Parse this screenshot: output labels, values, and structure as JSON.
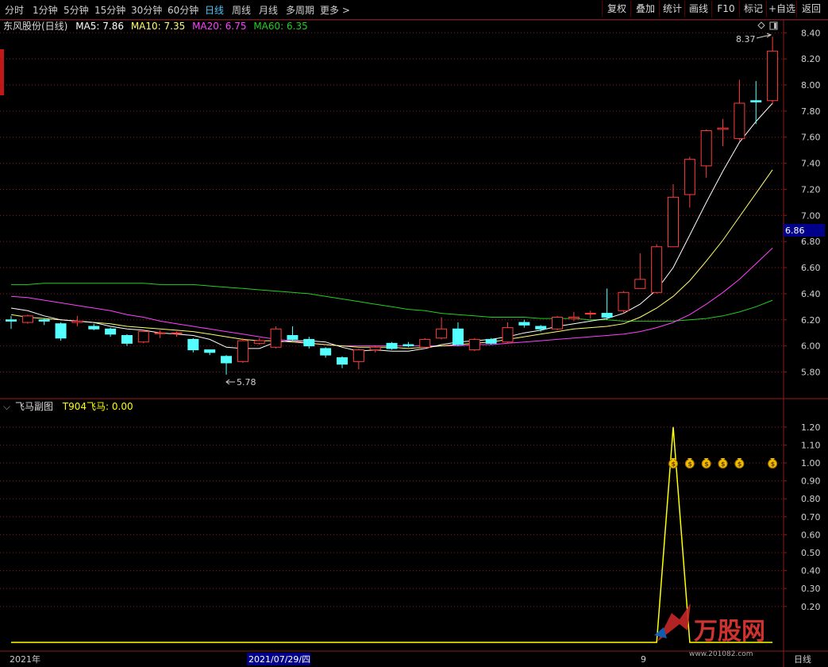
{
  "toolbar": {
    "periods": [
      "分时",
      "1分钟",
      "5分钟",
      "15分钟",
      "30分钟",
      "60分钟",
      "日线",
      "周线",
      "月线",
      "多周期",
      "更多 >"
    ],
    "active_period": "日线",
    "right_buttons": [
      "复权",
      "叠加",
      "统计",
      "画线",
      "F10",
      "标记",
      "+自选",
      "返回"
    ]
  },
  "main_header": {
    "title": "东风股份(日线)",
    "ma5": "MA5: 7.86",
    "ma10": "MA10: 7.35",
    "ma20": "MA20: 6.75",
    "ma60": "MA60: 6.35"
  },
  "sub_header": {
    "title": "飞马副图",
    "indicator": "T904飞马: 0.00"
  },
  "annotations": {
    "high": "8.37",
    "low": "5.78",
    "price_marker": "6.86",
    "period_corner": "日线"
  },
  "footer": {
    "year": "2021年",
    "cursor_date": "2021/07/29/四",
    "month_mark": "9"
  },
  "watermark": {
    "text": "万股网",
    "url": "www.201082.com"
  },
  "colors": {
    "up": "#ff3c3c",
    "down": "#54ffff",
    "ma5": "#ffffff",
    "ma10": "#ffff6e",
    "ma20": "#ff40ff",
    "ma60": "#20d020",
    "grid": "#8b1a1a",
    "indicator": "#ffff00",
    "price_marker_bg": "#00008b"
  },
  "chart_data": [
    {
      "type": "candlestick",
      "title": "东风股份(日线)",
      "y_ticks": [
        "8.40",
        "8.20",
        "8.00",
        "7.80",
        "7.60",
        "7.40",
        "7.20",
        "7.00",
        "6.80",
        "6.60",
        "6.40",
        "6.20",
        "6.00",
        "5.80"
      ],
      "ylim": [
        5.73,
        8.42
      ],
      "candles": [
        {
          "o": 6.2,
          "c": 6.19,
          "h": 6.23,
          "l": 6.13
        },
        {
          "o": 6.18,
          "c": 6.23,
          "h": 6.24,
          "l": 6.17
        },
        {
          "o": 6.2,
          "c": 6.19,
          "h": 6.21,
          "l": 6.16
        },
        {
          "o": 6.17,
          "c": 6.06,
          "h": 6.18,
          "l": 6.04
        },
        {
          "o": 6.18,
          "c": 6.19,
          "h": 6.23,
          "l": 6.15
        },
        {
          "o": 6.15,
          "c": 6.13,
          "h": 6.17,
          "l": 6.12
        },
        {
          "o": 6.13,
          "c": 6.09,
          "h": 6.14,
          "l": 6.07
        },
        {
          "o": 6.08,
          "c": 6.02,
          "h": 6.09,
          "l": 6.0
        },
        {
          "o": 6.03,
          "c": 6.11,
          "h": 6.12,
          "l": 6.02
        },
        {
          "o": 6.1,
          "c": 6.1,
          "h": 6.12,
          "l": 6.06
        },
        {
          "o": 6.1,
          "c": 6.1,
          "h": 6.11,
          "l": 6.07
        },
        {
          "o": 6.05,
          "c": 5.97,
          "h": 6.06,
          "l": 5.95
        },
        {
          "o": 5.97,
          "c": 5.95,
          "h": 5.97,
          "l": 5.93
        },
        {
          "o": 5.92,
          "c": 5.87,
          "h": 5.93,
          "l": 5.78
        },
        {
          "o": 5.88,
          "c": 6.04,
          "h": 6.06,
          "l": 5.87
        },
        {
          "o": 6.02,
          "c": 6.04,
          "h": 6.06,
          "l": 6.01
        },
        {
          "o": 5.99,
          "c": 6.13,
          "h": 6.15,
          "l": 5.98
        },
        {
          "o": 6.08,
          "c": 6.05,
          "h": 6.15,
          "l": 6.04
        },
        {
          "o": 6.05,
          "c": 6.0,
          "h": 6.07,
          "l": 5.98
        },
        {
          "o": 5.98,
          "c": 5.93,
          "h": 5.99,
          "l": 5.91
        },
        {
          "o": 5.91,
          "c": 5.86,
          "h": 5.92,
          "l": 5.83
        },
        {
          "o": 5.88,
          "c": 5.97,
          "h": 5.98,
          "l": 5.82
        },
        {
          "o": 5.97,
          "c": 5.99,
          "h": 6.0,
          "l": 5.95
        },
        {
          "o": 6.02,
          "c": 5.98,
          "h": 6.03,
          "l": 5.97
        },
        {
          "o": 6.01,
          "c": 6.0,
          "h": 6.03,
          "l": 5.99
        },
        {
          "o": 5.99,
          "c": 6.05,
          "h": 6.06,
          "l": 5.98
        },
        {
          "o": 6.06,
          "c": 6.13,
          "h": 6.22,
          "l": 6.05
        },
        {
          "o": 6.13,
          "c": 6.01,
          "h": 6.18,
          "l": 6.0
        },
        {
          "o": 5.97,
          "c": 6.05,
          "h": 6.06,
          "l": 5.96
        },
        {
          "o": 6.05,
          "c": 6.02,
          "h": 6.06,
          "l": 6.01
        },
        {
          "o": 6.03,
          "c": 6.14,
          "h": 6.18,
          "l": 6.02
        },
        {
          "o": 6.18,
          "c": 6.16,
          "h": 6.2,
          "l": 6.14
        },
        {
          "o": 6.15,
          "c": 6.13,
          "h": 6.16,
          "l": 6.11
        },
        {
          "o": 6.13,
          "c": 6.22,
          "h": 6.23,
          "l": 6.12
        },
        {
          "o": 6.21,
          "c": 6.22,
          "h": 6.26,
          "l": 6.19
        },
        {
          "o": 6.25,
          "c": 6.25,
          "h": 6.27,
          "l": 6.21
        },
        {
          "o": 6.25,
          "c": 6.22,
          "h": 6.44,
          "l": 6.2
        },
        {
          "o": 6.27,
          "c": 6.41,
          "h": 6.42,
          "l": 6.25
        },
        {
          "o": 6.44,
          "c": 6.51,
          "h": 6.71,
          "l": 6.44
        },
        {
          "o": 6.41,
          "c": 6.76,
          "h": 6.78,
          "l": 6.4
        },
        {
          "o": 6.76,
          "c": 7.14,
          "h": 7.24,
          "l": 6.76
        },
        {
          "o": 7.16,
          "c": 7.43,
          "h": 7.45,
          "l": 7.06
        },
        {
          "o": 7.38,
          "c": 7.65,
          "h": 7.66,
          "l": 7.29
        },
        {
          "o": 7.66,
          "c": 7.67,
          "h": 7.74,
          "l": 7.53
        },
        {
          "o": 7.59,
          "c": 7.86,
          "h": 8.04,
          "l": 7.57
        },
        {
          "o": 7.88,
          "c": 7.87,
          "h": 8.03,
          "l": 7.7
        },
        {
          "o": 7.88,
          "c": 8.26,
          "h": 8.37,
          "l": 7.85
        }
      ],
      "ma5": [
        6.29,
        6.27,
        6.23,
        6.2,
        6.19,
        6.18,
        6.15,
        6.13,
        6.12,
        6.1,
        6.09,
        6.08,
        6.05,
        5.99,
        5.98,
        5.98,
        6.03,
        6.04,
        6.04,
        6.03,
        5.99,
        5.96,
        5.97,
        5.96,
        5.96,
        5.98,
        6.01,
        6.03,
        6.04,
        6.05,
        6.07,
        6.1,
        6.12,
        6.15,
        6.17,
        6.19,
        6.21,
        6.25,
        6.32,
        6.43,
        6.6,
        6.85,
        7.1,
        7.34,
        7.56,
        7.72,
        7.86
      ],
      "ma10": [
        6.24,
        6.22,
        6.21,
        6.2,
        6.19,
        6.18,
        6.17,
        6.15,
        6.14,
        6.13,
        6.12,
        6.11,
        6.09,
        6.07,
        6.05,
        6.04,
        6.04,
        6.03,
        6.02,
        6.01,
        6.0,
        5.99,
        5.99,
        5.99,
        5.98,
        5.99,
        6.0,
        6.01,
        6.02,
        6.03,
        6.05,
        6.07,
        6.09,
        6.11,
        6.13,
        6.14,
        6.15,
        6.17,
        6.22,
        6.29,
        6.38,
        6.5,
        6.65,
        6.81,
        6.99,
        7.17,
        7.35
      ],
      "ma20": [
        6.38,
        6.37,
        6.35,
        6.33,
        6.31,
        6.29,
        6.27,
        6.24,
        6.22,
        6.19,
        6.17,
        6.15,
        6.13,
        6.11,
        6.09,
        6.07,
        6.05,
        6.04,
        6.02,
        6.01,
        6.0,
        6.0,
        6.0,
        6.0,
        6.0,
        6.0,
        6.0,
        6.0,
        6.01,
        6.01,
        6.02,
        6.03,
        6.04,
        6.05,
        6.06,
        6.07,
        6.08,
        6.09,
        6.11,
        6.14,
        6.18,
        6.24,
        6.32,
        6.41,
        6.51,
        6.63,
        6.75
      ],
      "ma60": [
        6.47,
        6.47,
        6.48,
        6.48,
        6.48,
        6.48,
        6.48,
        6.48,
        6.48,
        6.47,
        6.47,
        6.47,
        6.46,
        6.45,
        6.44,
        6.43,
        6.42,
        6.41,
        6.4,
        6.38,
        6.36,
        6.34,
        6.32,
        6.3,
        6.28,
        6.27,
        6.25,
        6.24,
        6.23,
        6.22,
        6.22,
        6.22,
        6.21,
        6.21,
        6.21,
        6.2,
        6.2,
        6.19,
        6.19,
        6.19,
        6.19,
        6.2,
        6.21,
        6.23,
        6.26,
        6.3,
        6.35
      ]
    },
    {
      "type": "line",
      "title": "飞马副图",
      "y_ticks": [
        "1.20",
        "1.10",
        "1.00",
        "0.90",
        "0.80",
        "0.70",
        "0.60",
        "0.50",
        "0.40",
        "0.30",
        "0.20"
      ],
      "ylim": [
        -0.04,
        1.27
      ],
      "series": [
        {
          "name": "T904飞马",
          "values": [
            0,
            0,
            0,
            0,
            0,
            0,
            0,
            0,
            0,
            0,
            0,
            0,
            0,
            0,
            0,
            0,
            0,
            0,
            0,
            0,
            0,
            0,
            0,
            0,
            0,
            0,
            0,
            0,
            0,
            0,
            0,
            0,
            0,
            0,
            0,
            0,
            0,
            0,
            0,
            0,
            1.2,
            0,
            0,
            0,
            0,
            0,
            0
          ]
        }
      ],
      "signal_markers": [
        {
          "index": 40,
          "value": 1.0
        },
        {
          "index": 41,
          "value": 1.0
        },
        {
          "index": 42,
          "value": 1.0
        },
        {
          "index": 43,
          "value": 1.0
        },
        {
          "index": 44,
          "value": 1.0
        },
        {
          "index": 46,
          "value": 1.0
        }
      ]
    }
  ]
}
